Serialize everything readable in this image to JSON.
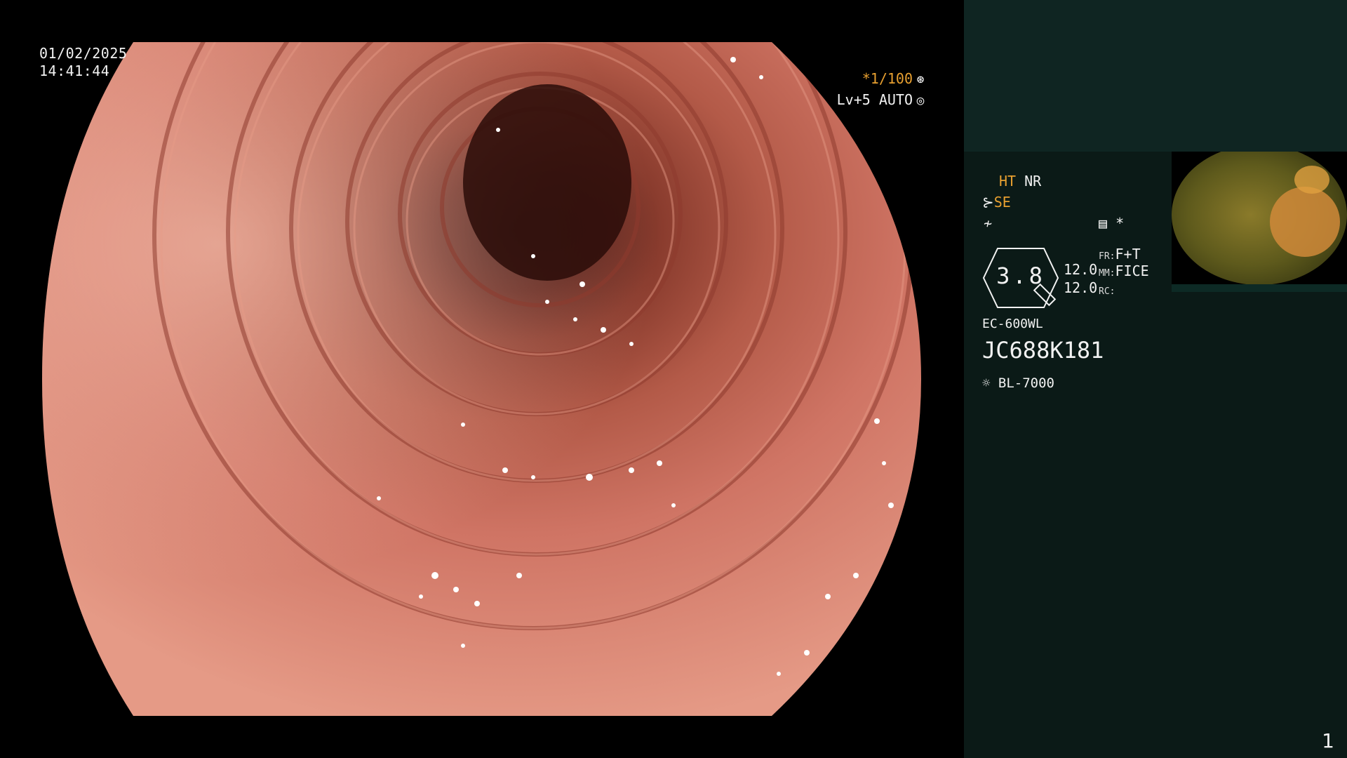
{
  "overlay": {
    "date": "01/02/2025",
    "time": "14:41:44",
    "shutter": "*1/100",
    "shutter_icon": "aperture-icon",
    "level": "Lv+5 AUTO",
    "level_icon": "iris-icon"
  },
  "panel": {
    "ht": "HT",
    "nr": "NR",
    "se": "SE",
    "se_icon": "enhance-icon",
    "sub_icon": "f-mode-icon",
    "menu_icon": "settings-list-icon",
    "star": "*",
    "magnification": "3.8",
    "val_top": "12.0",
    "val_bottom": "12.0",
    "fr_label": "FR:",
    "fr_value": "F+T",
    "mm_label": "MM:",
    "mm_value": "FICE",
    "rc_label": "RC:",
    "scope_model": "EC-600WL",
    "serial": "JC688K181",
    "light_source": "BL-7000",
    "light_icon": "light-source-icon",
    "frame_index": "1"
  },
  "colors": {
    "accent": "#e8a030",
    "panel_bg": "#0b1a17",
    "panel_top": "#0f2522",
    "mucosa": "#c86a5c"
  }
}
